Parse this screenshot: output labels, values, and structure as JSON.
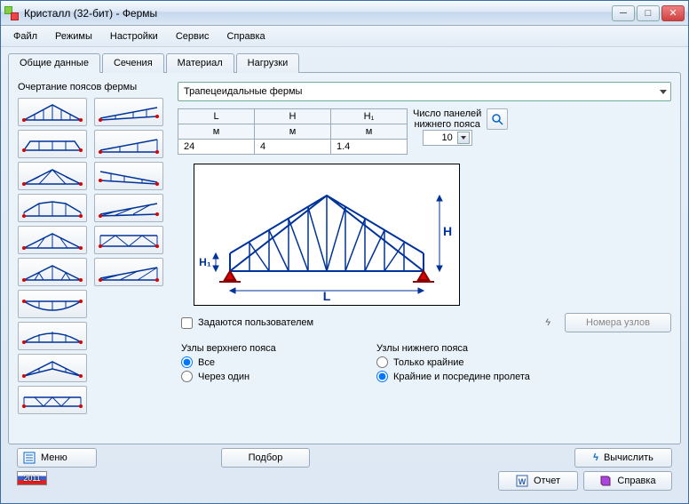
{
  "window": {
    "title": "Кристалл (32-бит) - Фермы"
  },
  "menu": {
    "file": "Файл",
    "modes": "Режимы",
    "settings": "Настройки",
    "service": "Сервис",
    "help": "Справка"
  },
  "tabs": {
    "general": "Общие данные",
    "sections": "Сечения",
    "material": "Материал",
    "loads": "Нагрузки"
  },
  "left": {
    "label": "Очертание поясов фермы"
  },
  "dropdown": {
    "selected": "Трапецеидальные фермы"
  },
  "table": {
    "h_L": "L",
    "h_H": "H",
    "h_H1": "H₁",
    "u": "м",
    "v_L": "24",
    "v_H": "4",
    "v_H1": "1.4",
    "panels_label1": "Число панелей",
    "panels_label2": "нижнего пояса",
    "panels_value": "10"
  },
  "opts": {
    "user_defined": "Задаются пользователем",
    "nodes_button": "Номера узлов",
    "upper_title": "Узлы верхнего пояса",
    "upper_all": "Все",
    "upper_alt": "Через один",
    "lower_title": "Узлы нижнего пояса",
    "lower_edge": "Только крайние",
    "lower_mid": "Крайние и посредине пролета"
  },
  "bottom": {
    "menu": "Меню",
    "year": "2011",
    "podbor": "Подбор",
    "compute": "Вычислить",
    "report": "Отчет",
    "help": "Справка"
  },
  "diagram": {
    "L": "L",
    "H": "H",
    "H1": "H₁"
  }
}
